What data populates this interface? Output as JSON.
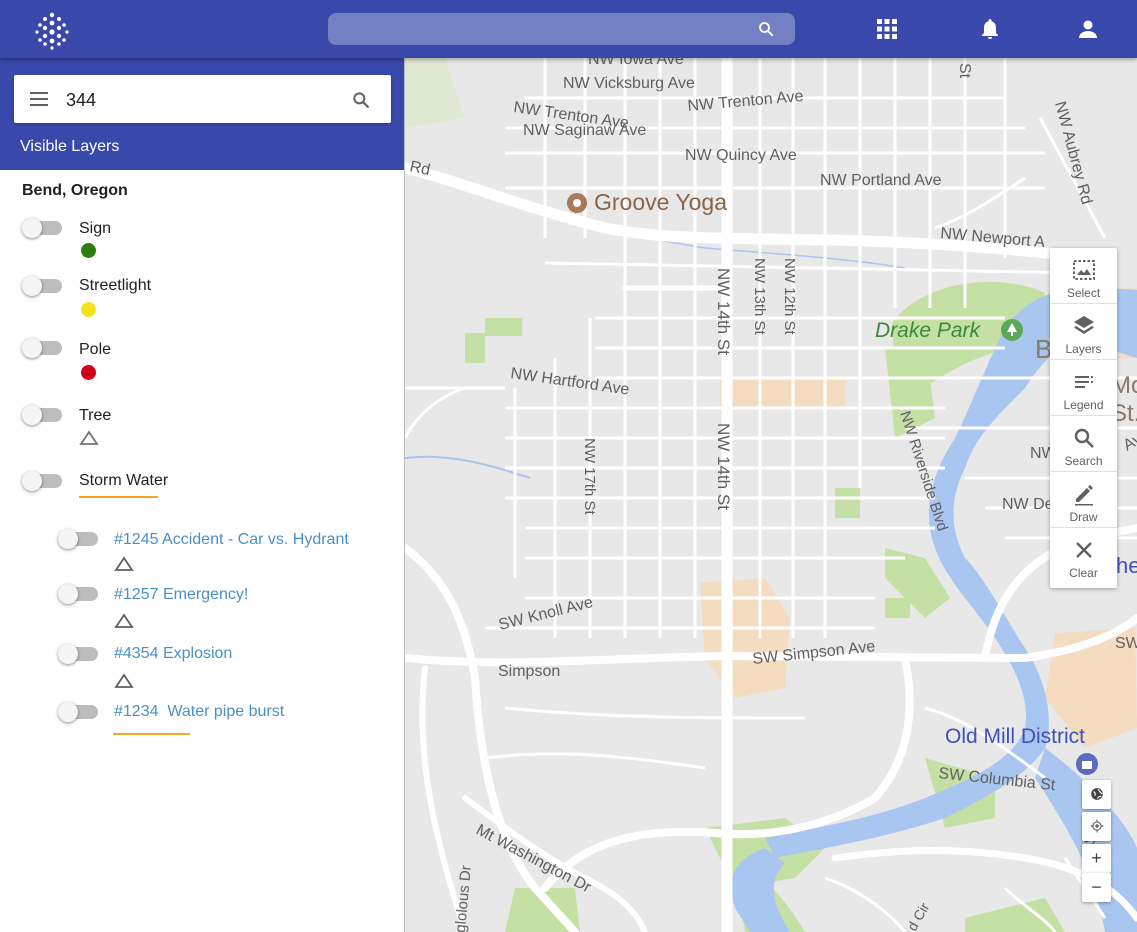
{
  "app": {
    "search_placeholder": "",
    "colors": {
      "primary": "#3949ab",
      "sign": "#2e7d12",
      "streetlight": "#f5e31a",
      "pole": "#d0021b",
      "storm_water": "#f5a623",
      "link": "#4a90c8"
    }
  },
  "panel": {
    "search_value": "344",
    "title": "Visible Layers",
    "region": "Bend, Oregon",
    "layers": [
      {
        "name": "Sign",
        "symbol": "dot-green"
      },
      {
        "name": "Streetlight",
        "symbol": "dot-yellow"
      },
      {
        "name": "Pole",
        "symbol": "dot-red"
      },
      {
        "name": "Tree",
        "symbol": "triangle"
      },
      {
        "name": "Storm Water",
        "symbol": "line-orange"
      }
    ],
    "sublayers": [
      {
        "name": "#1245 Accident - Car vs. Hydrant",
        "symbol": "triangle"
      },
      {
        "name": "#1257 Emergency!",
        "symbol": "triangle"
      },
      {
        "name": "#4354 Explosion",
        "symbol": "triangle"
      },
      {
        "name": "#1234  Water pipe burst",
        "symbol": "line-orange"
      }
    ]
  },
  "toolbar": {
    "select": "Select",
    "layers": "Layers",
    "legend": "Legend",
    "search": "Search",
    "draw": "Draw",
    "clear": "Clear"
  },
  "map": {
    "labels": {
      "iowa": "NW Iowa Ave",
      "vicksburg": "NW Vicksburg Ave",
      "trenton1": "NW Trenton Ave",
      "trenton2": "NW Trenton Ave",
      "saginaw": "NW Saginaw Ave",
      "quincy": "NW Quincy Ave",
      "portland": "NW Portland Ave",
      "newport": "NW Newport A",
      "aubrey": "NW Aubrey Rd",
      "rd": "Rd",
      "groove": "Groove Yoga",
      "drake": "Drake Park",
      "hartford": "NW Hartford Ave",
      "nw14a": "NW 14th St",
      "nw13": "NW 13th St",
      "nw12": "NW 12th St",
      "nw14b": "NW 14th St",
      "nw17": "NW 17th St",
      "riverside": "NW Riverside Blvd",
      "knoll": "SW Knoll Ave",
      "simpson": "Simpson",
      "swsimpson": "SW Simpson Ave",
      "oldmill": "Old Mill District",
      "columbia": "SW Columbia St",
      "washington": "Mt Washington Dr",
      "glolous": "glolous Dr",
      "b": "B",
      "mo": "Mo",
      "st": "St.",
      "he": "he",
      "nwd": "NW De",
      "nw": "NW",
      "sw1": "SW",
      "sw2": "Sw",
      "cir": "d Cir",
      "ave": "Ave",
      "st2": "St"
    },
    "zoom_in": "+",
    "zoom_out": "−"
  }
}
